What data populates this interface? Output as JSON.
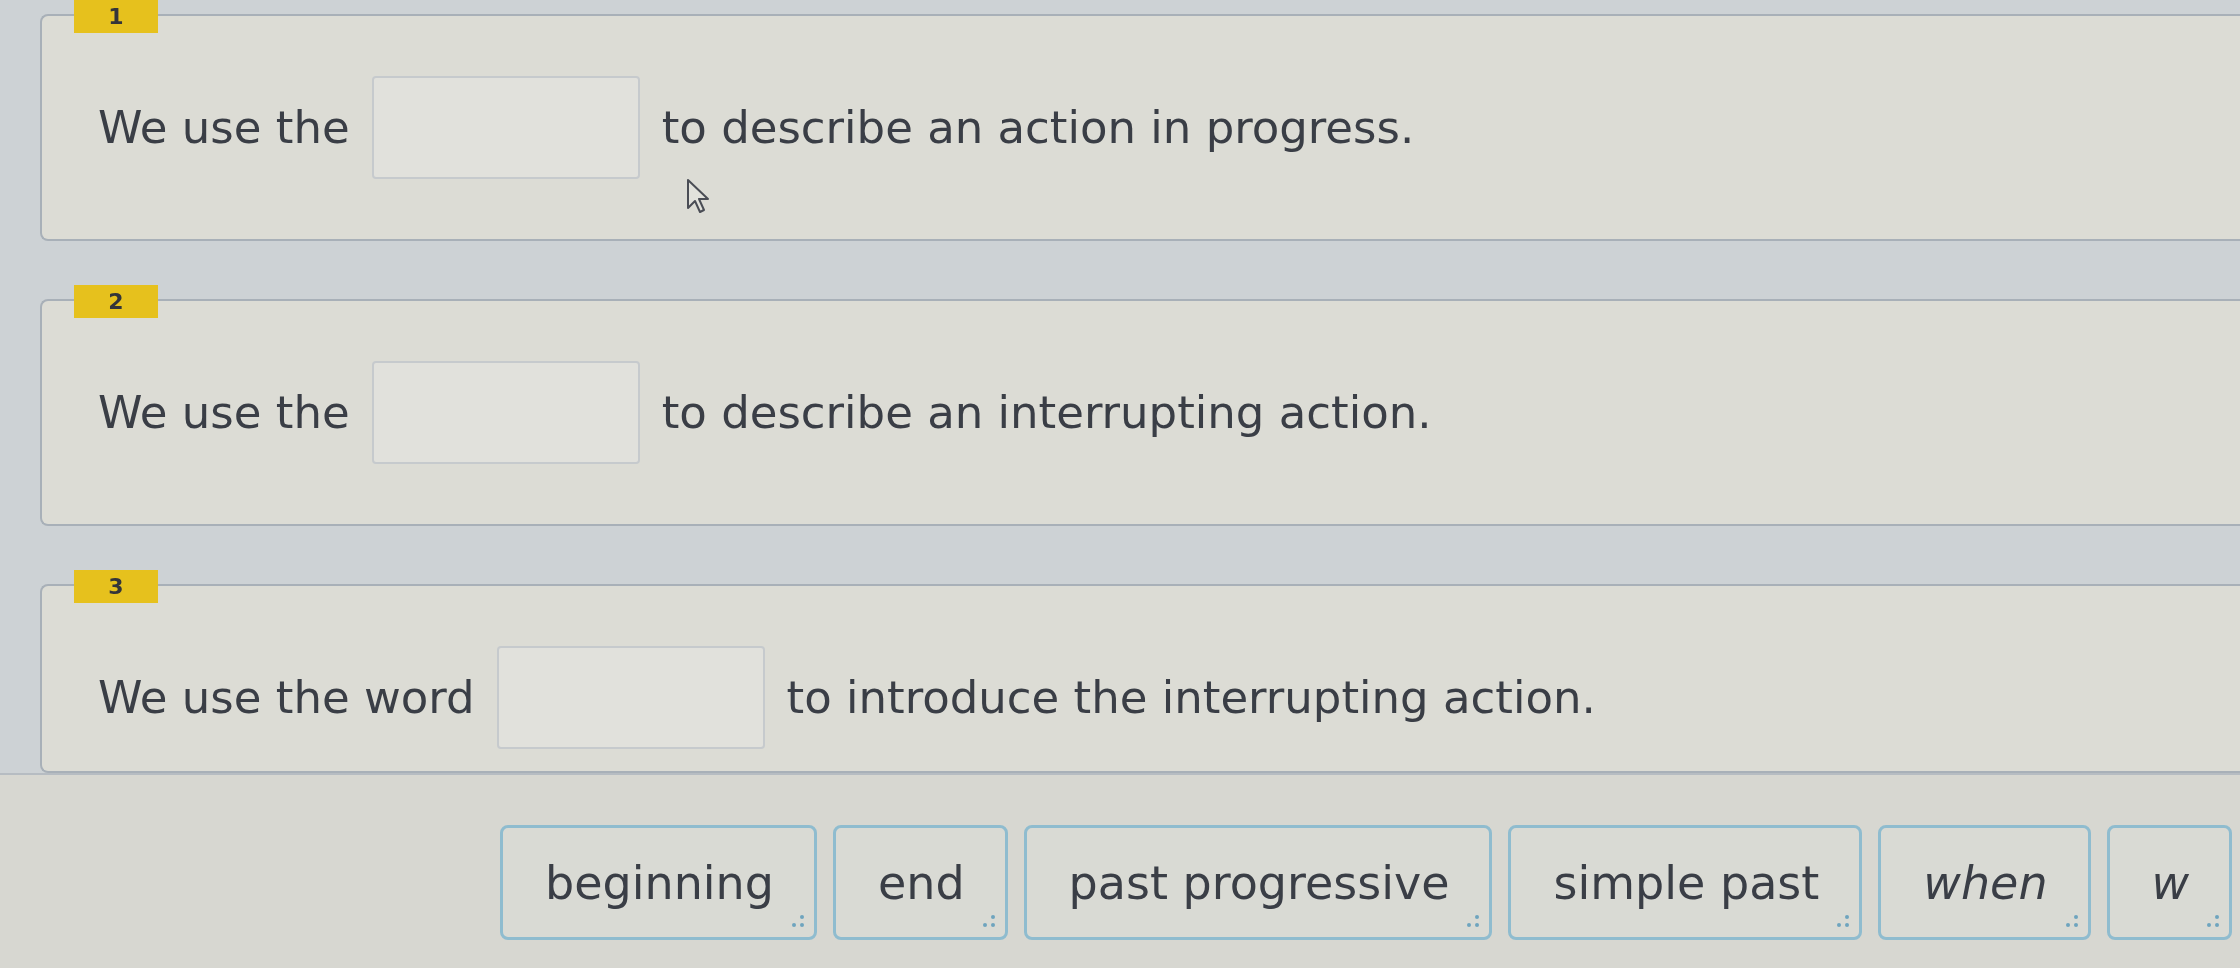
{
  "questions": [
    {
      "number": "1",
      "before": "We use the",
      "after": "to describe an action in progress."
    },
    {
      "number": "2",
      "before": "We use the",
      "after": "to describe an interrupting action."
    },
    {
      "number": "3",
      "before": "We use the word",
      "after": "to introduce the interrupting action."
    }
  ],
  "word_bank": [
    {
      "text": "beginning",
      "italic": false
    },
    {
      "text": "end",
      "italic": false
    },
    {
      "text": "past progressive",
      "italic": false
    },
    {
      "text": "simple past",
      "italic": false
    },
    {
      "text": "when",
      "italic": true
    },
    {
      "text": "w",
      "italic": true
    }
  ]
}
